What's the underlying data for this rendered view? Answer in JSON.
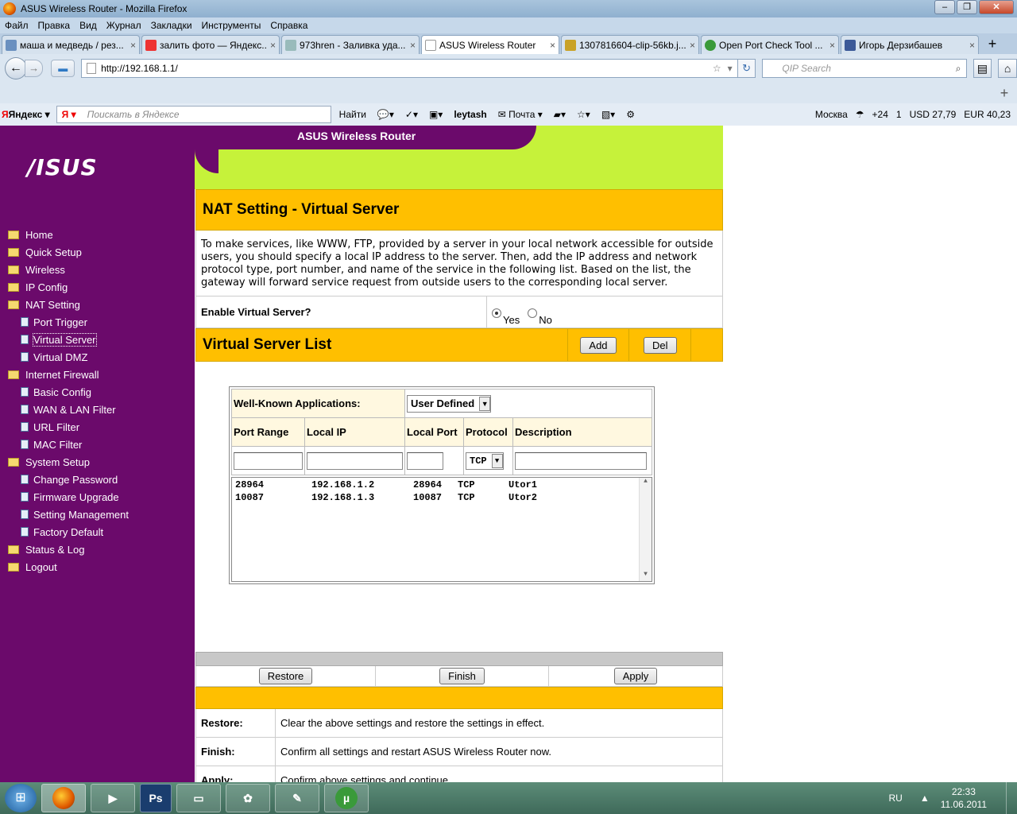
{
  "window": {
    "title": "ASUS Wireless Router - Mozilla Firefox",
    "menu": [
      "Файл",
      "Правка",
      "Вид",
      "Журнал",
      "Закладки",
      "Инструменты",
      "Справка"
    ]
  },
  "tabs": [
    {
      "label": "маша и медведь / рез..."
    },
    {
      "label": "залить фото — Яндекс..."
    },
    {
      "label": "973hren - Заливка уда..."
    },
    {
      "label": "ASUS Wireless Router"
    },
    {
      "label": "1307816604-clip-56kb.j..."
    },
    {
      "label": "Open Port Check Tool ..."
    },
    {
      "label": "Игорь Дерзибашев"
    }
  ],
  "nav": {
    "url": "http://192.168.1.1/",
    "search_placeholder": "QIP Search"
  },
  "yandex": {
    "logo": "Яндекс",
    "search_placeholder": "Поискать в Яндексе",
    "find": "Найти",
    "user": "leytash",
    "mail": "Почта",
    "city": "Москва",
    "temp": "+24",
    "counter": "1",
    "usd": "USD 27,79",
    "eur": "EUR 40,23"
  },
  "router": {
    "header_title": "ASUS Wireless Router",
    "logo": "/ISUS",
    "nav_items": [
      {
        "label": "Home",
        "type": "folder"
      },
      {
        "label": "Quick Setup",
        "type": "folder"
      },
      {
        "label": "Wireless",
        "type": "folder"
      },
      {
        "label": "IP Config",
        "type": "folder"
      },
      {
        "label": "NAT Setting",
        "type": "folder"
      },
      {
        "label": "Port Trigger",
        "type": "doc"
      },
      {
        "label": "Virtual Server",
        "type": "doc"
      },
      {
        "label": "Virtual DMZ",
        "type": "doc"
      },
      {
        "label": "Internet Firewall",
        "type": "folder"
      },
      {
        "label": "Basic Config",
        "type": "doc"
      },
      {
        "label": "WAN & LAN Filter",
        "type": "doc"
      },
      {
        "label": "URL Filter",
        "type": "doc"
      },
      {
        "label": "MAC Filter",
        "type": "doc"
      },
      {
        "label": "System Setup",
        "type": "folder"
      },
      {
        "label": "Change Password",
        "type": "doc"
      },
      {
        "label": "Firmware Upgrade",
        "type": "doc"
      },
      {
        "label": "Setting Management",
        "type": "doc"
      },
      {
        "label": "Factory Default",
        "type": "doc"
      },
      {
        "label": "Status & Log",
        "type": "folder"
      },
      {
        "label": "Logout",
        "type": "folder"
      }
    ],
    "section_title": "NAT Setting - Virtual Server",
    "description": "To make services, like WWW, FTP, provided by a server in your local network accessible for outside users, you should specify a local IP address to the server. Then, add the IP address and network protocol type, port number, and name of the service in the following list. Based on the list, the gateway will forward service request from outside users to the corresponding local server.",
    "enable_label": "Enable Virtual Server?",
    "yes": "Yes",
    "no": "No",
    "enabled": true,
    "list_title": "Virtual Server List",
    "add": "Add",
    "del": "Del",
    "wk_label": "Well-Known Applications:",
    "wk_value": "User Defined",
    "columns": [
      "Port Range",
      "Local IP",
      "Local Port",
      "Protocol",
      "Description"
    ],
    "protocol_value": "TCP",
    "entries": [
      {
        "port": "28964",
        "ip": "192.168.1.2",
        "lport": "28964",
        "proto": "TCP",
        "desc": "Utor1"
      },
      {
        "port": "10087",
        "ip": "192.168.1.3",
        "lport": "10087",
        "proto": "TCP",
        "desc": "Utor2"
      }
    ],
    "restore": "Restore",
    "finish": "Finish",
    "apply": "Apply",
    "help": [
      {
        "label": "Restore:",
        "text": "Clear the above settings and restore the settings in effect."
      },
      {
        "label": "Finish:",
        "text": "Confirm all settings and restart ASUS Wireless Router now."
      },
      {
        "label": "Apply:",
        "text": "Confirm above settings and continue."
      }
    ]
  },
  "taskbar": {
    "lang": "RU",
    "time": "22:33",
    "date": "11.06.2011"
  }
}
